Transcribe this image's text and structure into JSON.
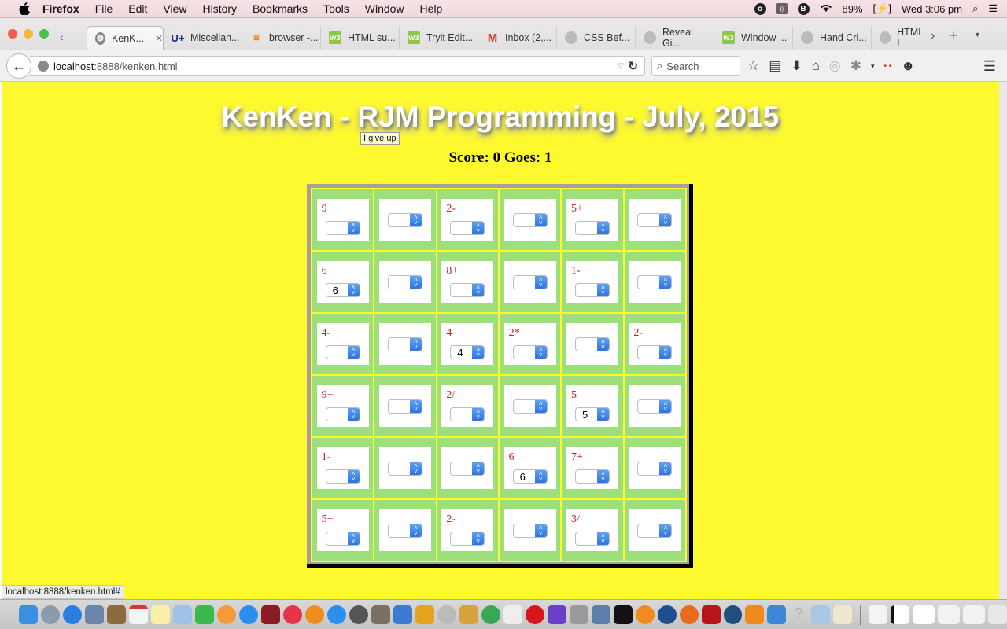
{
  "menubar": {
    "app": "Firefox",
    "items": [
      "File",
      "Edit",
      "View",
      "History",
      "Bookmarks",
      "Tools",
      "Window",
      "Help"
    ],
    "status": {
      "battery": "89%",
      "clock": "Wed 3:06 pm"
    }
  },
  "tabs": [
    {
      "label": "KenK...",
      "icon": "globe-icon",
      "active": true
    },
    {
      "label": "Miscellan...",
      "icon": "u-plus-icon"
    },
    {
      "label": "browser -...",
      "icon": "stackoverflow-icon"
    },
    {
      "label": "HTML su...",
      "icon": "w3schools-icon"
    },
    {
      "label": "Tryit Edit...",
      "icon": "w3schools-icon"
    },
    {
      "label": "Inbox (2,...",
      "icon": "gmail-icon"
    },
    {
      "label": "CSS Bef...",
      "icon": "generic-page-icon"
    },
    {
      "label": "Reveal Gi...",
      "icon": "generic-page-icon"
    },
    {
      "label": "Window ...",
      "icon": "w3schools-icon"
    },
    {
      "label": "Hand Cri...",
      "icon": "generic-page-icon"
    },
    {
      "label": "HTML I",
      "icon": "generic-page-icon"
    }
  ],
  "navbar": {
    "url_host": "localhost",
    "url_path": ":8888/kenken.html",
    "search_placeholder": "Search"
  },
  "page": {
    "title": "KenKen - RJM Programming - July, 2015",
    "tooltip": "I give up",
    "score_text": "Score: 0 Goes: 1",
    "colors": {
      "background": "#fef92f",
      "cell": "#9de07b",
      "label": "#cc1f1f"
    }
  },
  "grid": [
    [
      {
        "label": "9+",
        "value": ""
      },
      {
        "label": "",
        "value": ""
      },
      {
        "label": "2-",
        "value": ""
      },
      {
        "label": "",
        "value": ""
      },
      {
        "label": "5+",
        "value": ""
      },
      {
        "label": "",
        "value": ""
      }
    ],
    [
      {
        "label": "6",
        "value": "6"
      },
      {
        "label": "",
        "value": ""
      },
      {
        "label": "8+",
        "value": ""
      },
      {
        "label": "",
        "value": ""
      },
      {
        "label": "1-",
        "value": ""
      },
      {
        "label": "",
        "value": ""
      }
    ],
    [
      {
        "label": "4-",
        "value": ""
      },
      {
        "label": "",
        "value": ""
      },
      {
        "label": "4",
        "value": "4"
      },
      {
        "label": "2*",
        "value": ""
      },
      {
        "label": "",
        "value": ""
      },
      {
        "label": "2-",
        "value": ""
      }
    ],
    [
      {
        "label": "9+",
        "value": ""
      },
      {
        "label": "",
        "value": ""
      },
      {
        "label": "2/",
        "value": ""
      },
      {
        "label": "",
        "value": ""
      },
      {
        "label": "5",
        "value": "5"
      },
      {
        "label": "",
        "value": ""
      }
    ],
    [
      {
        "label": "1-",
        "value": ""
      },
      {
        "label": "",
        "value": ""
      },
      {
        "label": "",
        "value": ""
      },
      {
        "label": "6",
        "value": "6"
      },
      {
        "label": "7+",
        "value": ""
      },
      {
        "label": "",
        "value": ""
      }
    ],
    [
      {
        "label": "5+",
        "value": ""
      },
      {
        "label": "",
        "value": ""
      },
      {
        "label": "2-",
        "value": ""
      },
      {
        "label": "",
        "value": ""
      },
      {
        "label": "3/",
        "value": ""
      },
      {
        "label": "",
        "value": ""
      }
    ]
  ],
  "statusbar": {
    "link": "localhost:8888/kenken.html#"
  }
}
